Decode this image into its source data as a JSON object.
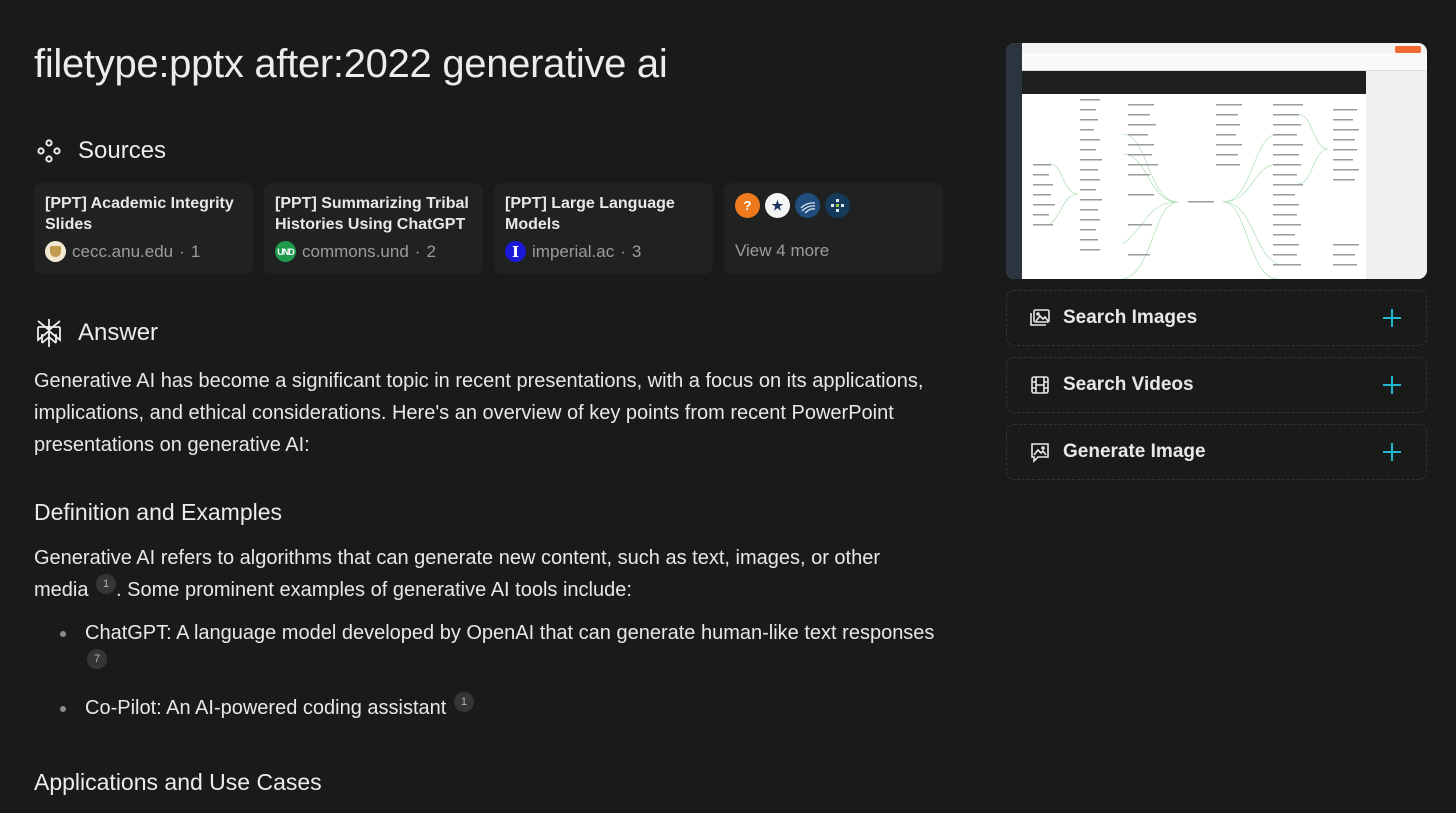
{
  "query": "filetype:pptx after:2022 generative ai",
  "sources": {
    "heading": "Sources",
    "items": [
      {
        "title": "[PPT] Academic Integrity Slides",
        "domain": "cecc.anu.edu",
        "index": "1",
        "favicon": "anu-shield-icon"
      },
      {
        "title": "[PPT] Summarizing Tribal Histories Using ChatGPT",
        "domain": "commons.und",
        "index": "2",
        "favicon": "und-logo-icon"
      },
      {
        "title": "[PPT] Large Language Models",
        "domain": "imperial.ac",
        "index": "3",
        "favicon": "imperial-logo-icon"
      }
    ],
    "more": {
      "label": "View 4 more",
      "icons": [
        "question-bubble-icon",
        "star-logo-icon",
        "globe-lines-icon",
        "grid-dots-icon"
      ]
    },
    "separator": "·"
  },
  "answer": {
    "heading": "Answer",
    "intro": "Generative AI has become a significant topic in recent presentations, with a focus on its applications, implications, and ethical considerations. Here's an overview of key points from recent PowerPoint presentations on generative AI:",
    "sections": [
      {
        "heading": "Definition and Examples",
        "paragraph_part1": "Generative AI refers to algorithms that can generate new content, such as text, images, or other media",
        "paragraph_cite": "1",
        "paragraph_part2": ". Some prominent examples of generative AI tools include:",
        "bullets": [
          {
            "text": "ChatGPT: A language model developed by OpenAI that can generate human-like text responses",
            "cite": "7"
          },
          {
            "text": "Co-Pilot: An AI-powered coding assistant",
            "cite": "1"
          }
        ]
      },
      {
        "heading": "Applications and Use Cases"
      }
    ]
  },
  "sidebar": {
    "preview_image": "mind-map-screenshot",
    "actions": [
      {
        "label": "Search Images",
        "icon": "images-icon"
      },
      {
        "label": "Search Videos",
        "icon": "film-icon"
      },
      {
        "label": "Generate Image",
        "icon": "generate-image-icon"
      }
    ],
    "accent_color": "#20b8cd"
  }
}
